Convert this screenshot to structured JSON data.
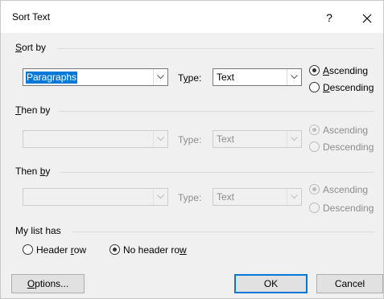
{
  "window": {
    "title": "Sort Text",
    "help_label": "?"
  },
  "sections": [
    {
      "label_parts": [
        "",
        "S",
        "ort by"
      ],
      "field": {
        "value": "Paragraphs",
        "selected": true,
        "disabled": false
      },
      "type_label_parts": [
        "T",
        "y",
        "pe:"
      ],
      "type_value": "Text",
      "asc_parts": [
        "",
        "A",
        "scending"
      ],
      "desc_parts": [
        "",
        "D",
        "escending"
      ],
      "order": "ascending",
      "disabled": false
    },
    {
      "label_parts": [
        "",
        "T",
        "hen by"
      ],
      "field": {
        "value": "",
        "selected": false,
        "disabled": true
      },
      "type_label_parts": [
        "Type:",
        "",
        ""
      ],
      "type_value": "Text",
      "asc_parts": [
        "Ascending",
        "",
        ""
      ],
      "desc_parts": [
        "Descending",
        "",
        ""
      ],
      "order": "ascending",
      "disabled": true
    },
    {
      "label_parts": [
        "Then ",
        "b",
        "y"
      ],
      "field": {
        "value": "",
        "selected": false,
        "disabled": true
      },
      "type_label_parts": [
        "Type:",
        "",
        ""
      ],
      "type_value": "Text",
      "asc_parts": [
        "Ascending",
        "",
        ""
      ],
      "desc_parts": [
        "Descending",
        "",
        ""
      ],
      "order": "ascending",
      "disabled": true
    }
  ],
  "list": {
    "label": "My list has",
    "header_row_parts": [
      "Header ",
      "r",
      "ow"
    ],
    "no_header_row_parts": [
      "No header ro",
      "w",
      ""
    ],
    "selected": "no_header_row"
  },
  "buttons": {
    "options_parts": [
      "",
      "O",
      "ptions..."
    ],
    "ok": "OK",
    "cancel": "Cancel"
  }
}
